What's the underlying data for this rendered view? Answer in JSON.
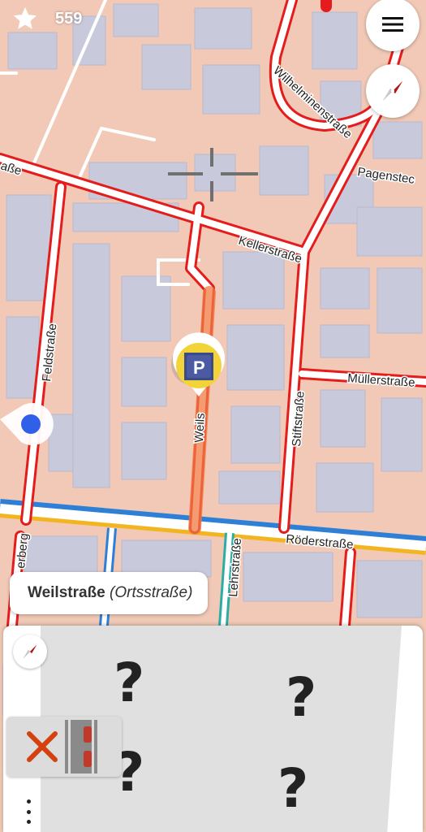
{
  "header": {
    "star_count": "559",
    "star_icon": "star-icon"
  },
  "buttons": {
    "menu_icon": "menu-icon",
    "compass_icon": "compass-icon"
  },
  "map": {
    "street_labels": {
      "wilhelminenstrasse": "Wilhelminenstraße",
      "pagenstec": "Pagenstec",
      "kellerstrasse": "Kellerstraße",
      "feldstrasse": "Feldstraße",
      "weils": "Weils",
      "stiftstrasse": "Stiftstraße",
      "muellerstrasse": "Müllerstraße",
      "roederstrasse": "Röderstraße",
      "lehrstrasse": "Lehrstraße",
      "erberg": "erberg",
      "asse": "aße"
    },
    "colors": {
      "residential_area": "#f1c9b6",
      "building": "#c9c9dc",
      "road_outline": "#e41c1c",
      "road_fill": "#ffffff",
      "highlight": "#f07a43",
      "main_road_blue": "#2e7fd6",
      "main_road_yellow": "#f2b51f",
      "location_dot": "#3060e8"
    },
    "marker_icon": "parking-marker-icon",
    "location_icon": "location-icon"
  },
  "street_chip": {
    "name": "Weilstraße",
    "type": "(Ortsstraße)"
  },
  "quest_panel": {
    "question_marks": [
      "?",
      "?",
      "?",
      "?"
    ],
    "undo_icon": "close-icon",
    "parking_icon": "car-parking-icon",
    "more_icon": "more-vertical-icon"
  }
}
